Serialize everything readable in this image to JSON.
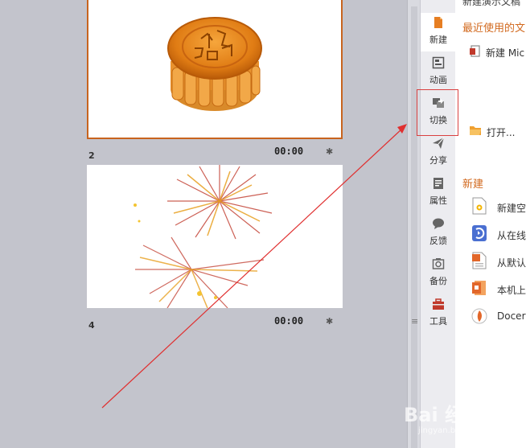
{
  "slides": [
    {
      "number": "",
      "time": "",
      "selected": true,
      "image": "mooncake"
    },
    {
      "number": "2",
      "time": "00:00",
      "selected": false,
      "image": "fireworks"
    },
    {
      "number": "4",
      "time": "00:00"
    }
  ],
  "tabs": [
    {
      "label": "新建",
      "icon": "new-file-icon",
      "active": true
    },
    {
      "label": "动画",
      "icon": "animation-icon"
    },
    {
      "label": "切换",
      "icon": "transition-icon",
      "highlighted": true
    },
    {
      "label": "分享",
      "icon": "share-icon"
    },
    {
      "label": "属性",
      "icon": "properties-icon"
    },
    {
      "label": "反馈",
      "icon": "feedback-icon"
    },
    {
      "label": "备份",
      "icon": "backup-icon"
    },
    {
      "label": "工具",
      "icon": "toolbox-icon"
    }
  ],
  "pane": {
    "cut_title": "新建演示文稿",
    "recent_title": "最近使用的文",
    "recent_item": "新建 Mic",
    "open_label": "打开...",
    "new_title": "新建",
    "new_items": [
      "新建空",
      "从在线",
      "从默认",
      "本机上",
      "Docer"
    ]
  },
  "watermark": {
    "text": "Bai 经验",
    "sub": "jingyan.baidu.com"
  },
  "colors": {
    "accent": "#d2691e",
    "annotation": "#d94040",
    "background": "#c3c4cc"
  }
}
